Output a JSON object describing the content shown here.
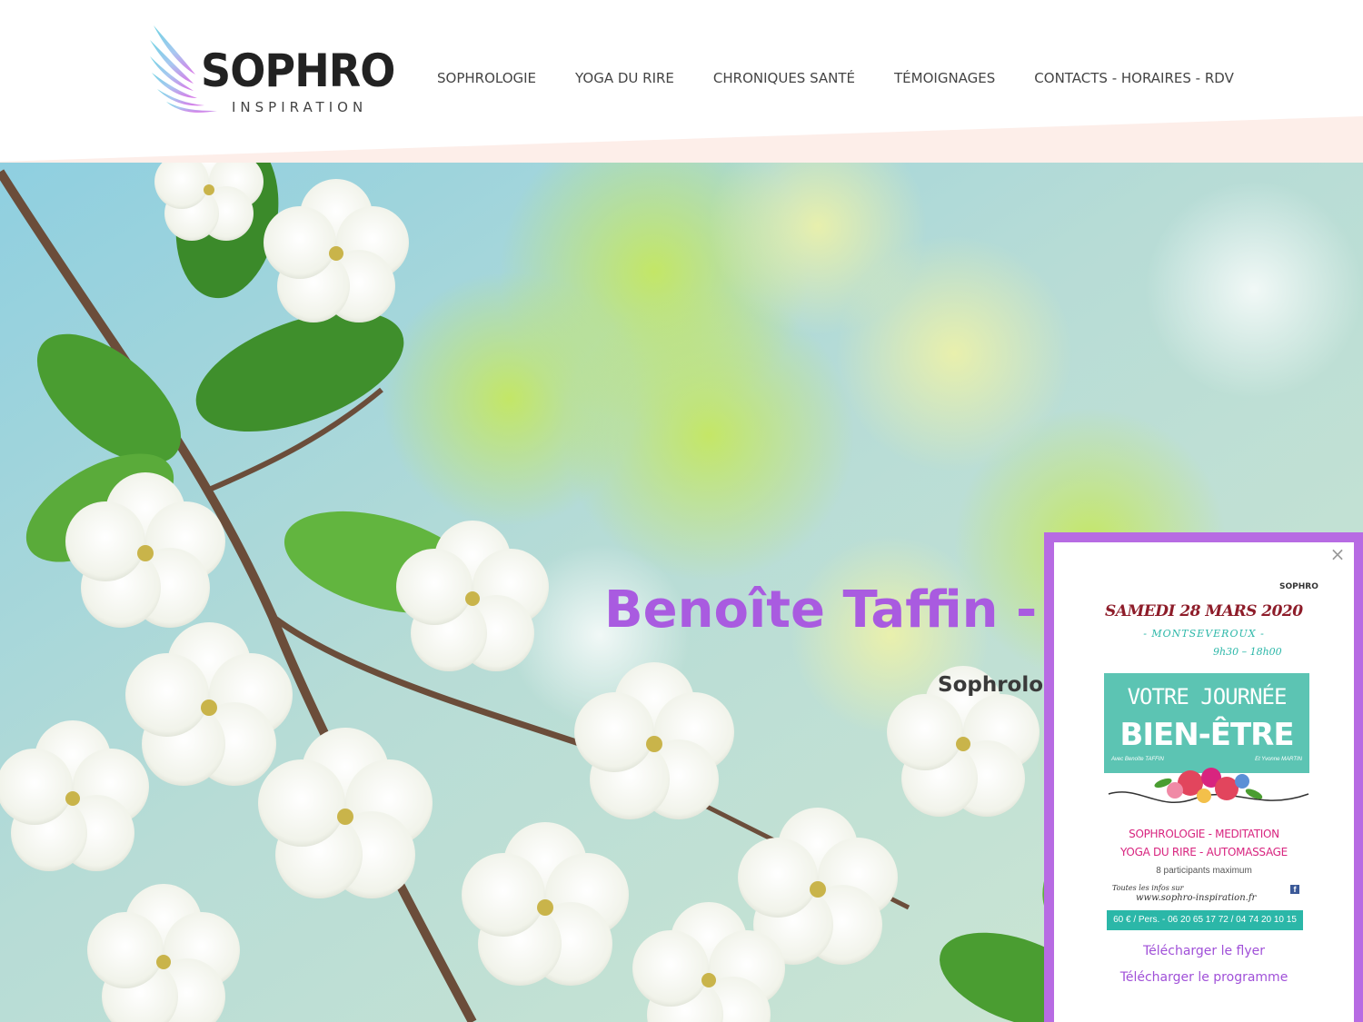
{
  "brand": {
    "name": "SOPHRO",
    "tagline": "INSPIRATION"
  },
  "nav": {
    "items": [
      {
        "label": "SOPHROLOGIE"
      },
      {
        "label": "YOGA DU RIRE"
      },
      {
        "label": "CHRONIQUES SANTÉ"
      },
      {
        "label": "TÉMOIGNAGES"
      },
      {
        "label": "CONTACTS - HORAIRES - RDV"
      }
    ]
  },
  "hero": {
    "title": "Benoîte Taffin - S",
    "subtitle": "Sophrolog"
  },
  "popup": {
    "close": "×",
    "flyer": {
      "logo": "SOPHRO",
      "date": "SAMEDI 28 MARS 2020",
      "place": "- MONTSEVEROUX -",
      "hours": "9h30 – 18h00",
      "headline1": "VOTRE JOURNÉE",
      "headline2": "BIEN-ÊTRE",
      "host_left": "Avec Benoîte TAFFIN",
      "host_right": "Et Yvonne MARTIN",
      "activities1": "SOPHROLOGIE - MEDITATION",
      "activities2": "YOGA DU RIRE - AUTOMASSAGE",
      "max": "8 participants maximum",
      "infos": "Toutes les infos sur",
      "url": "www.sophro-inspiration.fr",
      "price": "60 € / Pers.  -  06 20 65 17 72 / 04 74 20 10 15"
    },
    "link_flyer": "Télécharger le flyer",
    "link_program": "Télécharger le programme"
  },
  "colors": {
    "accent": "#a95be0",
    "popup_border": "#b76be3",
    "teal": "#2bb7a8"
  }
}
